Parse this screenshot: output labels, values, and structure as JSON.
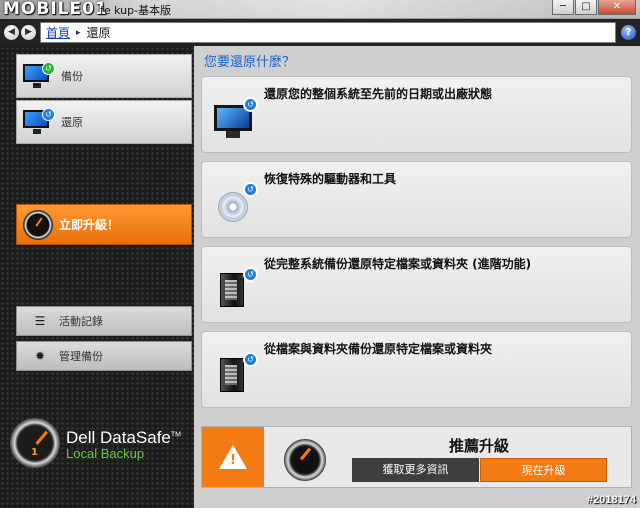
{
  "window": {
    "watermark": "MOBILE01",
    "title": "fe  kup-基本版",
    "minimize": "─",
    "maximize": "□",
    "close": "✕"
  },
  "nav": {
    "back": "◀",
    "forward": "▶",
    "home": "首頁",
    "separator": "▸",
    "current": "還原",
    "help": "?"
  },
  "sidebar": {
    "backup_label": "備份",
    "restore_label": "還原",
    "upgrade_label": "立即升級！",
    "log_label": "活動記錄",
    "manage_label": "管理備份",
    "brand_name": "Dell DataSafe",
    "brand_tm": "TM",
    "brand_sub": "Local Backup",
    "gauge_number": "1"
  },
  "main": {
    "prompt": "您要還原什麼？",
    "options": [
      {
        "label": "還原您的整個系統至先前的日期或出廠狀態"
      },
      {
        "label": "恢復特殊的驅動器和工具"
      },
      {
        "label": "從完整系統備份還原特定檔案或資料夾 (進階功能)"
      },
      {
        "label": "從檔案與資料夾備份還原特定檔案或資料夾"
      }
    ]
  },
  "recommend": {
    "title": "推薦升級",
    "more_info": "獲取更多資訊",
    "upgrade_now": "現在升級",
    "warn_mark": "!"
  },
  "footer_id": "#2018174",
  "colors": {
    "accent_orange": "#f27b13",
    "link_blue": "#1d63c6",
    "sidebar_bg": "#1c1c1c",
    "brand_green": "#6fc04b"
  }
}
